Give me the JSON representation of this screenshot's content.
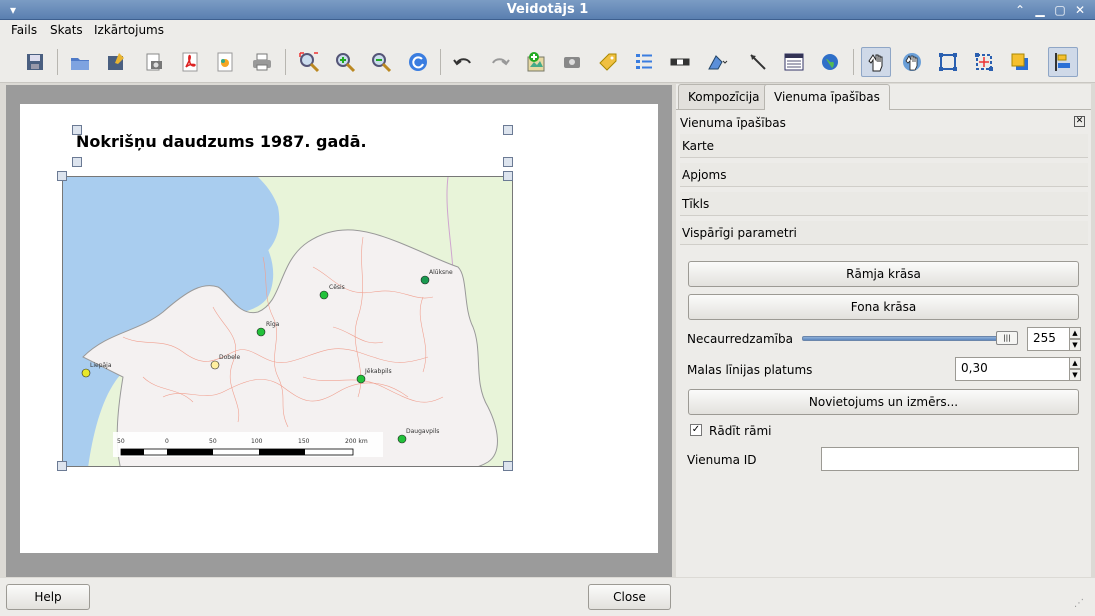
{
  "window": {
    "title": "Veidotājs 1"
  },
  "menu": [
    "Fails",
    "Skats",
    "Izkārtojums"
  ],
  "toolbar": {
    "icons": [
      "save-icon",
      "open-template-icon",
      "save-template-icon",
      "export-image-icon",
      "export-pdf-icon",
      "export-svg-icon",
      "print-icon",
      "zoom-full-icon",
      "zoom-in-icon",
      "zoom-out-icon",
      "refresh-icon",
      "undo-icon",
      "redo-icon",
      "add-map-icon",
      "add-image-icon",
      "add-label-icon",
      "add-legend-icon",
      "add-scalebar-icon",
      "add-shape-icon",
      "add-arrow-icon",
      "add-table-icon",
      "add-html-icon",
      "select-move-icon",
      "move-content-icon",
      "group-icon",
      "ungroup-icon",
      "raise-icon",
      "align-icon"
    ]
  },
  "page": {
    "title": "Nokrišņu daudzums 1987. gadā.",
    "map": {
      "cities": [
        "Cēsis",
        "Alūksne",
        "Rīga",
        "Dobele",
        "Liepāja",
        "Jēkabpils",
        "Daugavpils"
      ],
      "scalebar": [
        "50",
        "0",
        "50",
        "100",
        "150",
        "200 km"
      ]
    }
  },
  "panel": {
    "tabs": [
      "Kompozīcija",
      "Vienuma īpašības"
    ],
    "header": "Vienuma īpašības",
    "sections": [
      "Karte",
      "Apjoms",
      "Tīkls",
      "Vispārīgi parametri"
    ],
    "frame_color": "Rāmja krāsa",
    "bg_color": "Fona krāsa",
    "opacity_label": "Necaurredzamība",
    "opacity_value": "255",
    "outline_label": "Malas līnijas platums",
    "outline_value": "0,30",
    "position_button": "Novietojums un izmērs...",
    "show_frame": "Rādīt rāmi",
    "item_id_label": "Vienuma ID",
    "item_id_value": ""
  },
  "footer": {
    "help": "Help",
    "close": "Close"
  }
}
